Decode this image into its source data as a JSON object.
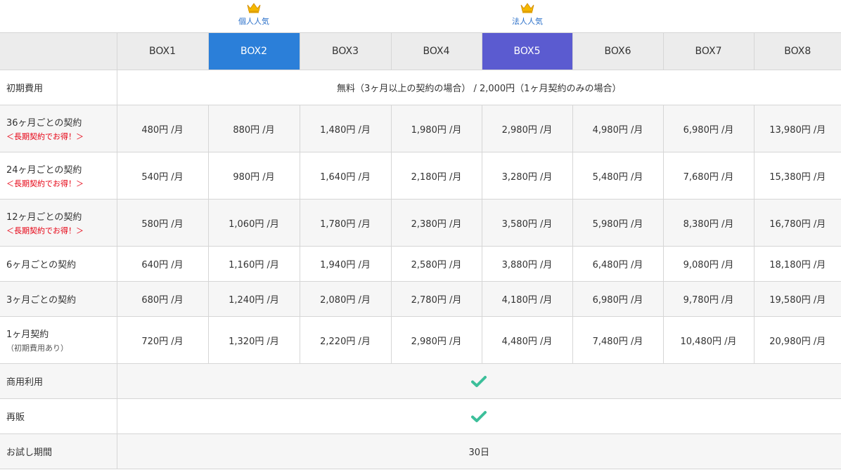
{
  "badges": [
    {
      "text": "個人人気",
      "icon": "crown-icon"
    },
    {
      "text": "法人人気",
      "icon": "crown-icon"
    }
  ],
  "columns": [
    "BOX1",
    "BOX2",
    "BOX3",
    "BOX4",
    "BOX5",
    "BOX6",
    "BOX7",
    "BOX8"
  ],
  "rows": {
    "initial_fee": {
      "label": "初期費用",
      "value": "無料（3ヶ月以上の契約の場合） / 2,000円（1ヶ月契約のみの場合）"
    },
    "m36": {
      "label": "36ヶ月ごとの契約",
      "note": "＜長期契約でお得！＞",
      "prices": [
        "480円 /月",
        "880円 /月",
        "1,480円 /月",
        "1,980円 /月",
        "2,980円 /月",
        "4,980円 /月",
        "6,980円 /月",
        "13,980円 /月"
      ]
    },
    "m24": {
      "label": "24ヶ月ごとの契約",
      "note": "＜長期契約でお得！＞",
      "prices": [
        "540円 /月",
        "980円 /月",
        "1,640円 /月",
        "2,180円 /月",
        "3,280円 /月",
        "5,480円 /月",
        "7,680円 /月",
        "15,380円 /月"
      ]
    },
    "m12": {
      "label": "12ヶ月ごとの契約",
      "note": "＜長期契約でお得！＞",
      "prices": [
        "580円 /月",
        "1,060円 /月",
        "1,780円 /月",
        "2,380円 /月",
        "3,580円 /月",
        "5,980円 /月",
        "8,380円 /月",
        "16,780円 /月"
      ]
    },
    "m6": {
      "label": "6ヶ月ごとの契約",
      "prices": [
        "640円 /月",
        "1,160円 /月",
        "1,940円 /月",
        "2,580円 /月",
        "3,880円 /月",
        "6,480円 /月",
        "9,080円 /月",
        "18,180円 /月"
      ]
    },
    "m3": {
      "label": "3ヶ月ごとの契約",
      "prices": [
        "680円 /月",
        "1,240円 /月",
        "2,080円 /月",
        "2,780円 /月",
        "4,180円 /月",
        "6,980円 /月",
        "9,780円 /月",
        "19,580円 /月"
      ]
    },
    "m1": {
      "label": "1ヶ月契約",
      "note": "（初期費用あり）",
      "prices": [
        "720円 /月",
        "1,320円 /月",
        "2,220円 /月",
        "2,980円 /月",
        "4,480円 /月",
        "7,480円 /月",
        "10,480円 /月",
        "20,980円 /月"
      ]
    },
    "commercial": {
      "label": "商用利用",
      "icon": "checkmark-icon"
    },
    "resale": {
      "label": "再販",
      "icon": "checkmark-icon"
    },
    "trial": {
      "label": "お試し期間",
      "value": "30日"
    }
  },
  "colors": {
    "box2_header": "#2b7fd9",
    "box5_header": "#5b5bd0",
    "check": "#3cbf9a",
    "note_red": "#e60012",
    "badge_text": "#2a6fc9"
  }
}
